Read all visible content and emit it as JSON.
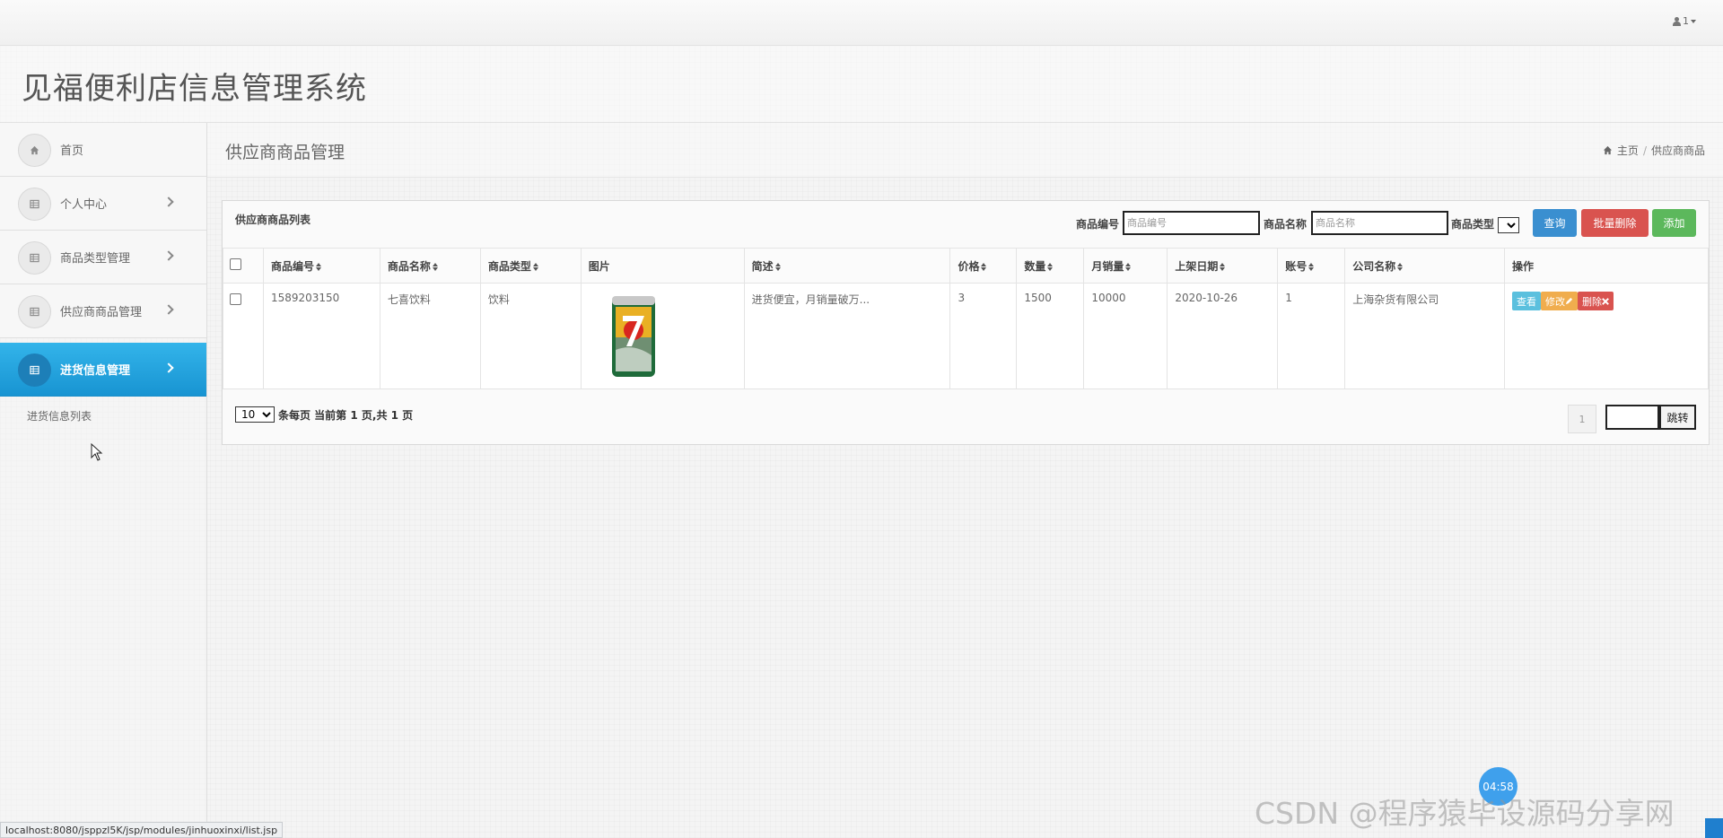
{
  "topbar": {
    "user_label": "1"
  },
  "brand": {
    "title": "见福便利店信息管理系统"
  },
  "sidebar": {
    "items": [
      {
        "label": "首页"
      },
      {
        "label": "个人中心"
      },
      {
        "label": "商品类型管理"
      },
      {
        "label": "供应商商品管理"
      },
      {
        "label": "进货信息管理"
      }
    ],
    "sub_item": "进货信息列表"
  },
  "header": {
    "title": "供应商商品管理",
    "breadcrumb": {
      "home": "主页",
      "sep": "/",
      "current": "供应商商品"
    }
  },
  "panel": {
    "title": "供应商商品列表",
    "search": {
      "code_label": "商品编号",
      "code_placeholder": "商品编号",
      "name_label": "商品名称",
      "name_placeholder": "商品名称",
      "type_label": "商品类型"
    },
    "buttons": {
      "query": "查询",
      "batch_delete": "批量删除",
      "add": "添加"
    },
    "columns": [
      "商品编号",
      "商品名称",
      "商品类型",
      "图片",
      "简述",
      "价格",
      "数量",
      "月销量",
      "上架日期",
      "账号",
      "公司名称",
      "操作"
    ],
    "rows": [
      {
        "code": "1589203150",
        "name": "七喜饮料",
        "type": "饮料",
        "desc": "进货便宜，月销量破万...",
        "price": "3",
        "qty": "1500",
        "monthly_sales": "10000",
        "date": "2020-10-26",
        "account": "1",
        "company": "上海杂货有限公司",
        "actions": {
          "view": "查看",
          "edit": "修改",
          "delete": "删除"
        }
      }
    ],
    "pager": {
      "page_size": "10",
      "info": "条每页 当前第 1 页,共 1 页",
      "current_page": "1",
      "jump_label": "跳转"
    }
  },
  "status_url": "localhost:8080/jsppzl5K/jsp/modules/jinhuoxinxi/list.jsp",
  "overlay": {
    "timer": "04:58",
    "watermark": "CSDN @程序猿毕设源码分享网"
  },
  "colors": {
    "primary": "#3a8fd0",
    "danger": "#d9534f",
    "success": "#5cb85c",
    "active_nav": "#1894d2"
  }
}
